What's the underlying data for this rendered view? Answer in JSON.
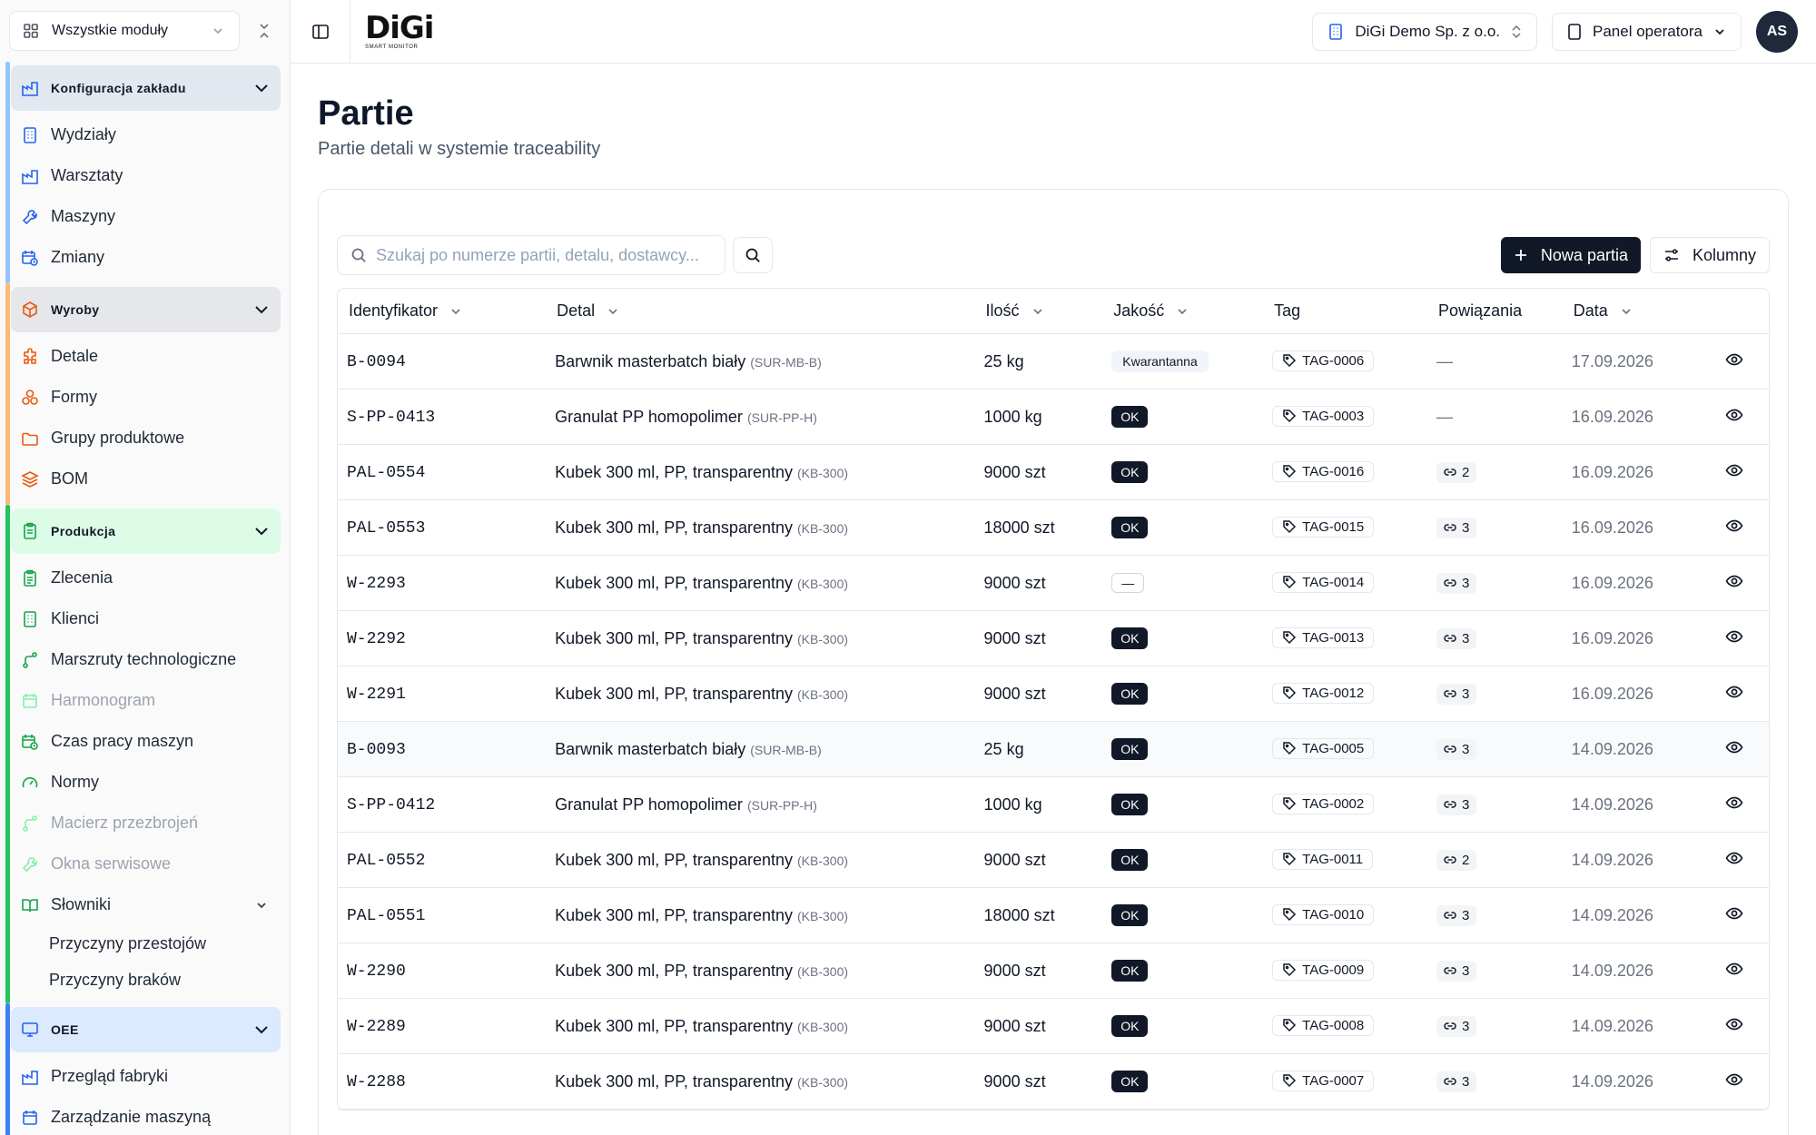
{
  "sidebar": {
    "module_select": "Wszystkie moduły",
    "groups": [
      {
        "title": "Konfiguracja zakładu",
        "color": "#93c5fd",
        "head_bg": "#e2e8f0",
        "items": [
          {
            "label": "Wydziały",
            "icon": "building-icon"
          },
          {
            "label": "Warsztaty",
            "icon": "factory-icon"
          },
          {
            "label": "Maszyny",
            "icon": "wrench-icon"
          },
          {
            "label": "Zmiany",
            "icon": "calendar-clock-icon"
          }
        ]
      },
      {
        "title": "Wyroby",
        "color": "#fdba74",
        "head_bg": "#e5e7eb",
        "items": [
          {
            "label": "Detale",
            "icon": "puzzle-icon"
          },
          {
            "label": "Formy",
            "icon": "shapes-icon"
          },
          {
            "label": "Grupy produktowe",
            "icon": "folder-icon"
          },
          {
            "label": "BOM",
            "icon": "layers-icon"
          }
        ]
      },
      {
        "title": "Produkcja",
        "color": "#22c55e",
        "head_bg": "#dcfce7",
        "items": [
          {
            "label": "Zlecenia",
            "icon": "clipboard-icon"
          },
          {
            "label": "Klienci",
            "icon": "building-icon"
          },
          {
            "label": "Marszruty technologiczne",
            "icon": "route-icon"
          },
          {
            "label": "Harmonogram",
            "icon": "calendar-icon",
            "dim": true
          },
          {
            "label": "Czas pracy maszyn",
            "icon": "calendar-clock-icon"
          },
          {
            "label": "Normy",
            "icon": "gauge-icon"
          },
          {
            "label": "Macierz przezbrojeń",
            "icon": "route-icon",
            "dim": true
          },
          {
            "label": "Okna serwisowe",
            "icon": "wrench-icon",
            "dim": true
          },
          {
            "label": "Słowniki",
            "icon": "book-icon",
            "expandable": true
          }
        ],
        "subitems": [
          "Przyczyny przestojów",
          "Przyczyny braków"
        ]
      },
      {
        "title": "OEE",
        "color": "#3b82f6",
        "head_bg": "#dbeafe",
        "items": [
          {
            "label": "Przegląd fabryki",
            "icon": "factory-icon"
          },
          {
            "label": "Zarządzanie maszyną",
            "icon": "calendar-icon"
          }
        ]
      }
    ]
  },
  "topbar": {
    "logo_mark": "DiGi",
    "logo_sub": "SMART MONITOR",
    "company": "DiGi Demo Sp. z o.o.",
    "panel": "Panel operatora",
    "avatar": "AS"
  },
  "page": {
    "title": "Partie",
    "subtitle": "Partie detali w systemie traceability"
  },
  "toolbar": {
    "search_placeholder": "Szukaj po numerze partii, detalu, dostawcy...",
    "new_label": "Nowa partia",
    "columns_label": "Kolumny"
  },
  "table": {
    "headers": [
      "Identyfikator",
      "Detal",
      "Ilość",
      "Jakość",
      "Tag",
      "Powiązania",
      "Data"
    ],
    "rows": [
      {
        "id": "B-0094",
        "detail": "Barwnik masterbatch biały",
        "code": "(SUR-MB-B)",
        "qty": "25 kg",
        "quality": "Kwarantanna",
        "qtype": "kw",
        "tag": "TAG-0006",
        "links": "—",
        "date": "17.09.2026"
      },
      {
        "id": "S-PP-0413",
        "detail": "Granulat PP homopolimer",
        "code": "(SUR-PP-H)",
        "qty": "1000 kg",
        "quality": "OK",
        "qtype": "ok",
        "tag": "TAG-0003",
        "links": "—",
        "date": "16.09.2026"
      },
      {
        "id": "PAL-0554",
        "detail": "Kubek 300 ml, PP, transparentny",
        "code": "(KB-300)",
        "qty": "9000 szt",
        "quality": "OK",
        "qtype": "ok",
        "tag": "TAG-0016",
        "links": "2",
        "date": "16.09.2026"
      },
      {
        "id": "PAL-0553",
        "detail": "Kubek 300 ml, PP, transparentny",
        "code": "(KB-300)",
        "qty": "18000 szt",
        "quality": "OK",
        "qtype": "ok",
        "tag": "TAG-0015",
        "links": "3",
        "date": "16.09.2026"
      },
      {
        "id": "W-2293",
        "detail": "Kubek 300 ml, PP, transparentny",
        "code": "(KB-300)",
        "qty": "9000 szt",
        "quality": "—",
        "qtype": "dash",
        "tag": "TAG-0014",
        "links": "3",
        "date": "16.09.2026"
      },
      {
        "id": "W-2292",
        "detail": "Kubek 300 ml, PP, transparentny",
        "code": "(KB-300)",
        "qty": "9000 szt",
        "quality": "OK",
        "qtype": "ok",
        "tag": "TAG-0013",
        "links": "3",
        "date": "16.09.2026"
      },
      {
        "id": "W-2291",
        "detail": "Kubek 300 ml, PP, transparentny",
        "code": "(KB-300)",
        "qty": "9000 szt",
        "quality": "OK",
        "qtype": "ok",
        "tag": "TAG-0012",
        "links": "3",
        "date": "16.09.2026"
      },
      {
        "id": "B-0093",
        "detail": "Barwnik masterbatch biały",
        "code": "(SUR-MB-B)",
        "qty": "25 kg",
        "quality": "OK",
        "qtype": "ok",
        "tag": "TAG-0005",
        "links": "3",
        "date": "14.09.2026",
        "highlight": true
      },
      {
        "id": "S-PP-0412",
        "detail": "Granulat PP homopolimer",
        "code": "(SUR-PP-H)",
        "qty": "1000 kg",
        "quality": "OK",
        "qtype": "ok",
        "tag": "TAG-0002",
        "links": "3",
        "date": "14.09.2026"
      },
      {
        "id": "PAL-0552",
        "detail": "Kubek 300 ml, PP, transparentny",
        "code": "(KB-300)",
        "qty": "9000 szt",
        "quality": "OK",
        "qtype": "ok",
        "tag": "TAG-0011",
        "links": "2",
        "date": "14.09.2026"
      },
      {
        "id": "PAL-0551",
        "detail": "Kubek 300 ml, PP, transparentny",
        "code": "(KB-300)",
        "qty": "18000 szt",
        "quality": "OK",
        "qtype": "ok",
        "tag": "TAG-0010",
        "links": "3",
        "date": "14.09.2026"
      },
      {
        "id": "W-2290",
        "detail": "Kubek 300 ml, PP, transparentny",
        "code": "(KB-300)",
        "qty": "9000 szt",
        "quality": "OK",
        "qtype": "ok",
        "tag": "TAG-0009",
        "links": "3",
        "date": "14.09.2026"
      },
      {
        "id": "W-2289",
        "detail": "Kubek 300 ml, PP, transparentny",
        "code": "(KB-300)",
        "qty": "9000 szt",
        "quality": "OK",
        "qtype": "ok",
        "tag": "TAG-0008",
        "links": "3",
        "date": "14.09.2026"
      },
      {
        "id": "W-2288",
        "detail": "Kubek 300 ml, PP, transparentny",
        "code": "(KB-300)",
        "qty": "9000 szt",
        "quality": "OK",
        "qtype": "ok",
        "tag": "TAG-0007",
        "links": "3",
        "date": "14.09.2026"
      }
    ]
  }
}
